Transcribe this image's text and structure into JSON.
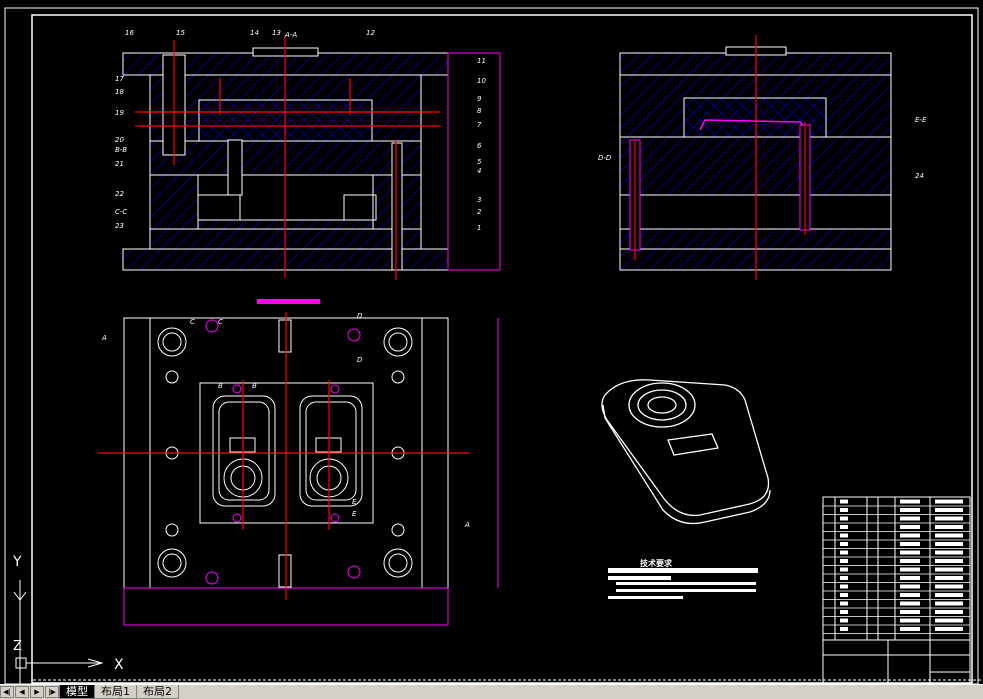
{
  "app": {
    "name": "AutoCAD drawing"
  },
  "layout_tabs": [
    {
      "label": "模型",
      "active": true
    },
    {
      "label": "布局1",
      "active": false
    },
    {
      "label": "布局2",
      "active": false
    }
  ],
  "nav_buttons": [
    "first",
    "previous",
    "next",
    "last"
  ],
  "ucs": {
    "x_label": "X",
    "y_label": "Y",
    "z_label": "Z"
  },
  "drawing": {
    "section_main_title": "A-A",
    "section_labels_right": [
      "12",
      "11",
      "10",
      "9",
      "8",
      "7",
      "6",
      "5",
      "4",
      "3",
      "2",
      "1"
    ],
    "section_labels_left": [
      "16",
      "17",
      "18",
      "19",
      "20",
      "B-B",
      "21",
      "22",
      "C-C",
      "23"
    ],
    "section_labels_top": [
      "15",
      "14",
      "13"
    ],
    "side_view_labels": [
      "D-D",
      "E-E",
      "24"
    ],
    "plan_labels": [
      "A",
      "A",
      "B",
      "B",
      "C",
      "C",
      "D",
      "D",
      "E",
      "E"
    ],
    "tech_requirements_title": "技术要求"
  },
  "colors": {
    "background": "#000000",
    "outline": "#ffffff",
    "hatch": "#0000ff",
    "centerline": "#ff0000",
    "dimension": "#ff00ff",
    "tabbar": "#d4d0c8"
  }
}
